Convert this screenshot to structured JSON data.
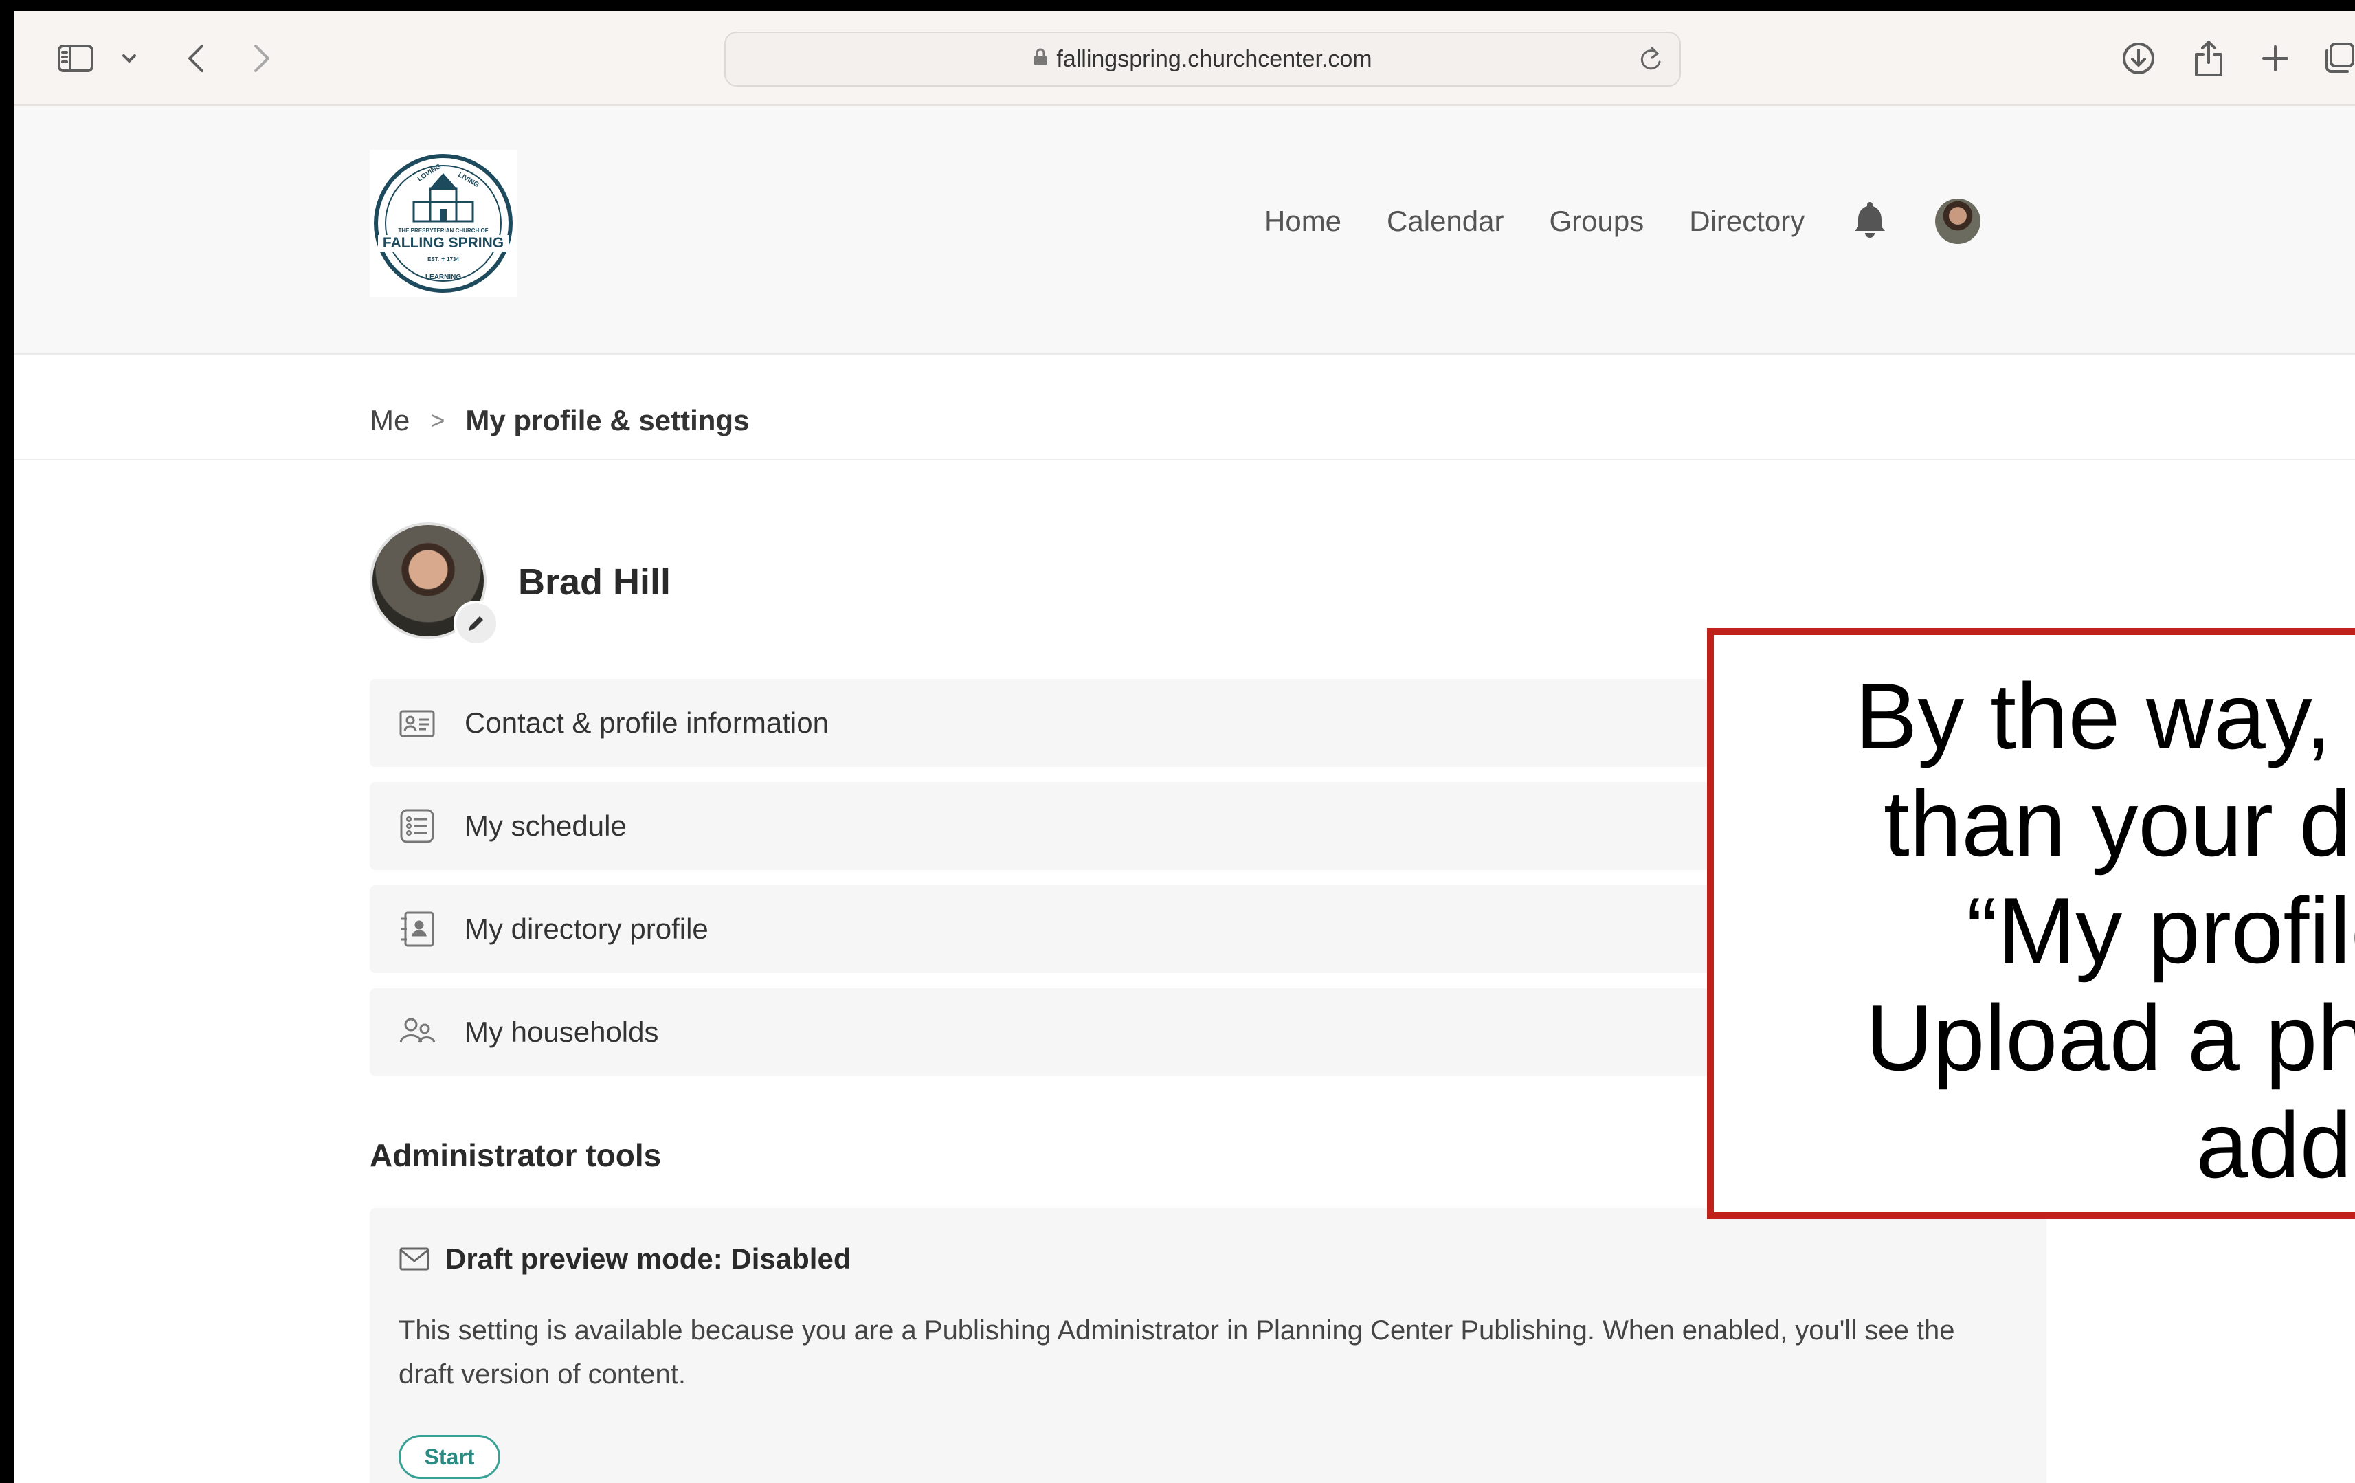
{
  "browser": {
    "url": "fallingspring.churchcenter.com"
  },
  "header": {
    "logo_lines": [
      "LOVING",
      "LIVING",
      "THE PRESBYTERIAN CHURCH OF",
      "FALLING SPRING",
      "EST. 1734",
      "LEARNING"
    ],
    "nav": [
      "Home",
      "Calendar",
      "Groups",
      "Directory"
    ]
  },
  "breadcrumb": {
    "root": "Me",
    "separator": ">",
    "current": "My profile & settings"
  },
  "profile": {
    "name": "Brad Hill"
  },
  "menu": [
    {
      "label": "Contact & profile information",
      "icon": "id-card-icon"
    },
    {
      "label": "My schedule",
      "icon": "list-icon"
    },
    {
      "label": "My directory profile",
      "icon": "contact-book-icon"
    },
    {
      "label": "My households",
      "icon": "people-icon"
    }
  ],
  "admin": {
    "title": "Administrator tools",
    "draft_title": "Draft preview mode: Disabled",
    "draft_desc": "This setting is available because you are a Publishing Administrator in Planning Center Publishing. When enabled, you'll see the draft version of content.",
    "start_label": "Start"
  },
  "callout": {
    "lines": [
      "By the way, y",
      "than your dir",
      "“My profile",
      "Upload a pho",
      "add"
    ],
    "border_color": "#c0211b"
  }
}
